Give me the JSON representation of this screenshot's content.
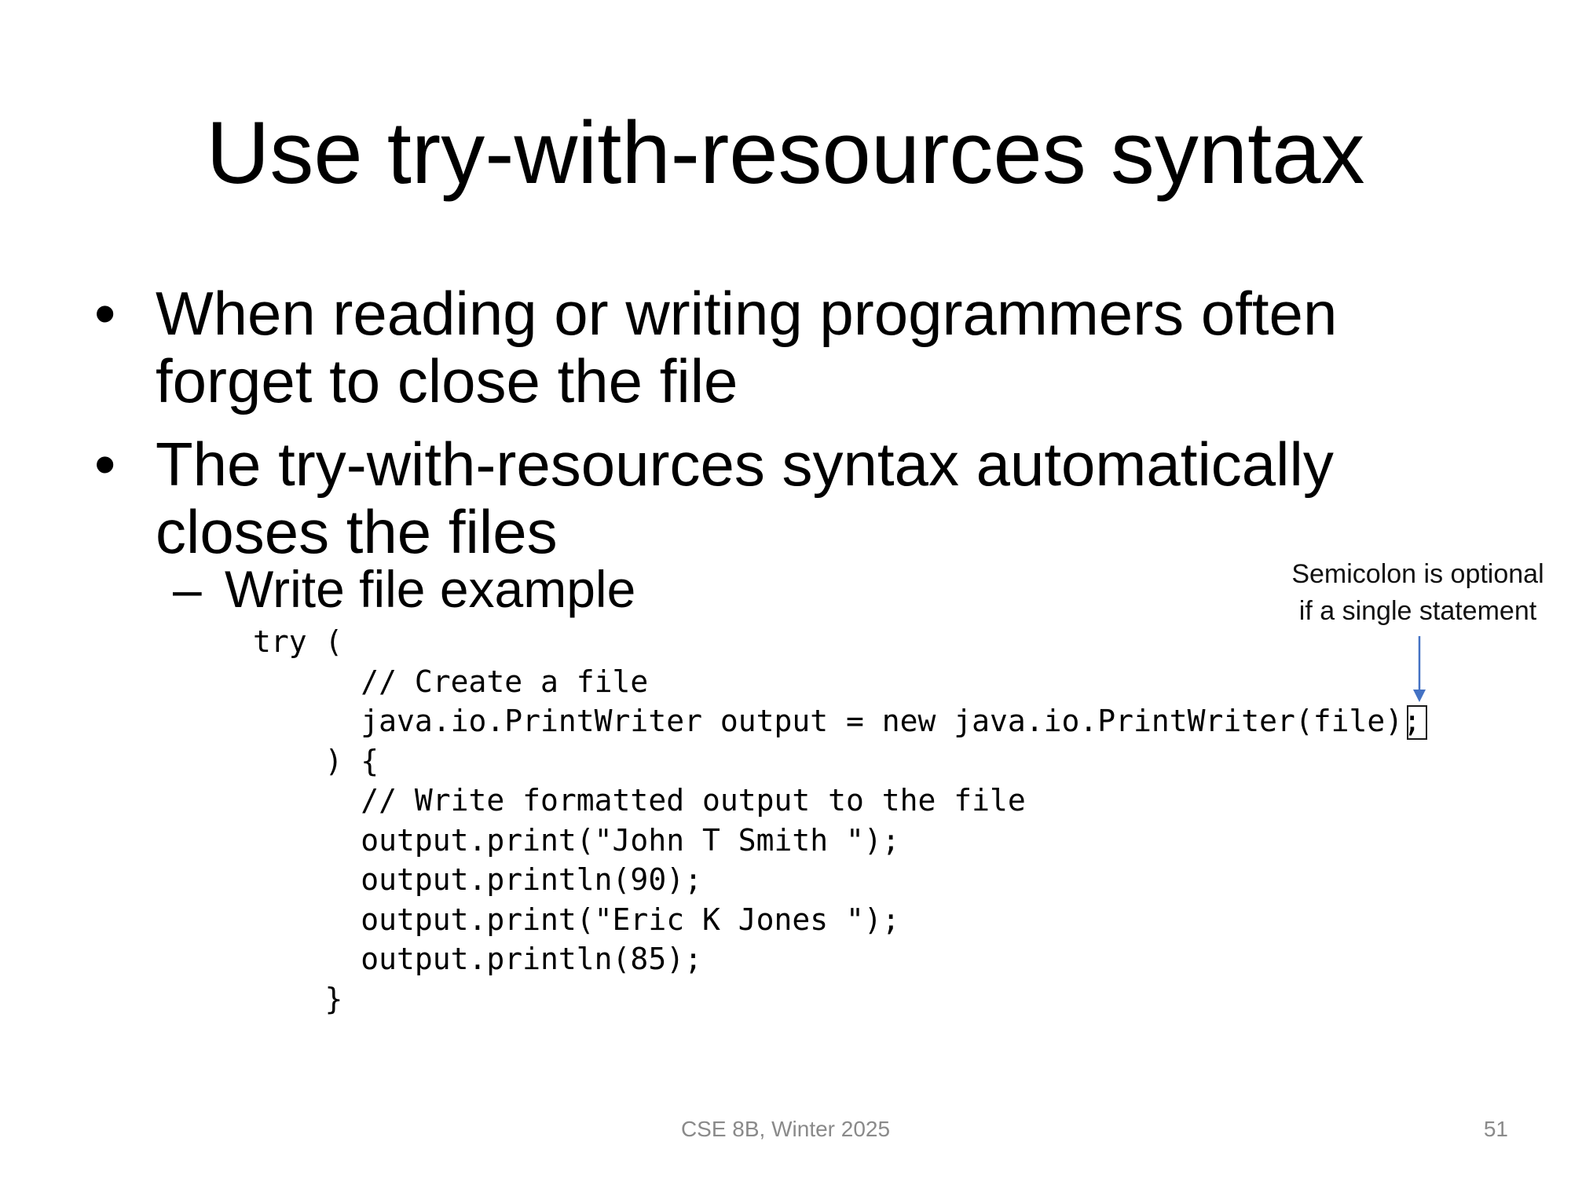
{
  "slide": {
    "title": "Use try-with-resources syntax",
    "bullets": [
      {
        "marker": "•",
        "line1": "When reading or writing programmers often",
        "line2": "forget to close the file"
      },
      {
        "marker": "•",
        "line1": "The try-with-resources syntax automatically",
        "line2": "closes the files"
      }
    ],
    "sub_bullet": {
      "marker": "–",
      "text": "Write file example"
    },
    "code_lines": [
      "try (",
      "      // Create a file",
      "      java.io.PrintWriter output = new java.io.PrintWriter(file);",
      "    ) {",
      "      // Write formatted output to the file",
      "      output.print(\"John T Smith \");",
      "      output.println(90);",
      "      output.print(\"Eric K Jones \");",
      "      output.println(85);",
      "    }"
    ],
    "annotation": {
      "line1": "Semicolon is optional",
      "line2": "if a single statement",
      "arrow_color": "#4472c4"
    },
    "footer": {
      "course": "CSE 8B, Winter 2025",
      "page_number": "51"
    }
  }
}
